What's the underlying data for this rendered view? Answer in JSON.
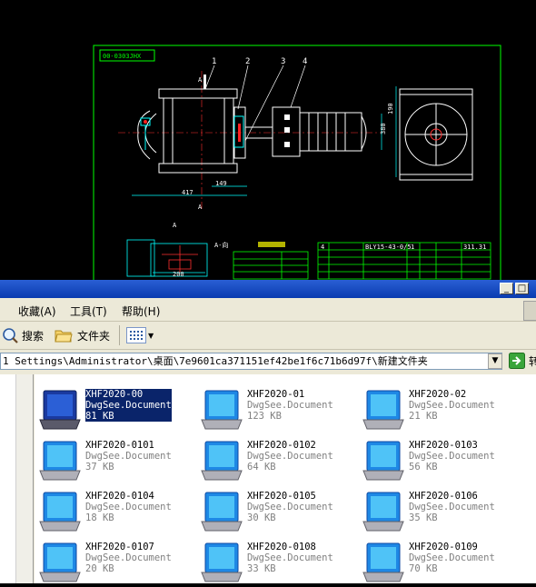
{
  "cad": {
    "title_block": "00-0303JHX",
    "balloons": [
      "1",
      "2",
      "3",
      "4"
    ],
    "dims": {
      "d417": "417",
      "d149": "149",
      "d380": "380",
      "d190": "190",
      "d200": "200"
    },
    "section_marks": [
      "A",
      "A",
      "A",
      "A-向"
    ],
    "row1": "4",
    "model": "BLY15-43-0/5",
    "qty": "1",
    "code": "311.31"
  },
  "window": {
    "menu": [
      "收藏(A)",
      "工具(T)",
      "帮助(H)"
    ],
    "toolbar": {
      "search": "搜索",
      "folders": "文件夹"
    },
    "address": "1 Settings\\Administrator\\桌面\\7e9601ca371151ef42be1f6c71b6d97f\\新建文件夹",
    "go_label": "转"
  },
  "files": [
    {
      "name": "XHF2020-00",
      "type": "DwgSee.Document",
      "size": "81 KB",
      "selected": true
    },
    {
      "name": "XHF2020-01",
      "type": "DwgSee.Document",
      "size": "123 KB"
    },
    {
      "name": "XHF2020-02",
      "type": "DwgSee.Document",
      "size": "21 KB"
    },
    {
      "name": "XHF2020-0101",
      "type": "DwgSee.Document",
      "size": "37 KB"
    },
    {
      "name": "XHF2020-0102",
      "type": "DwgSee.Document",
      "size": "64 KB"
    },
    {
      "name": "XHF2020-0103",
      "type": "DwgSee.Document",
      "size": "56 KB"
    },
    {
      "name": "XHF2020-0104",
      "type": "DwgSee.Document",
      "size": "18 KB"
    },
    {
      "name": "XHF2020-0105",
      "type": "DwgSee.Document",
      "size": "30 KB"
    },
    {
      "name": "XHF2020-0106",
      "type": "DwgSee.Document",
      "size": "35 KB"
    },
    {
      "name": "XHF2020-0107",
      "type": "DwgSee.Document",
      "size": "20 KB"
    },
    {
      "name": "XHF2020-0108",
      "type": "DwgSee.Document",
      "size": "33 KB"
    },
    {
      "name": "XHF2020-0109",
      "type": "DwgSee.Document",
      "size": "70 KB"
    }
  ]
}
